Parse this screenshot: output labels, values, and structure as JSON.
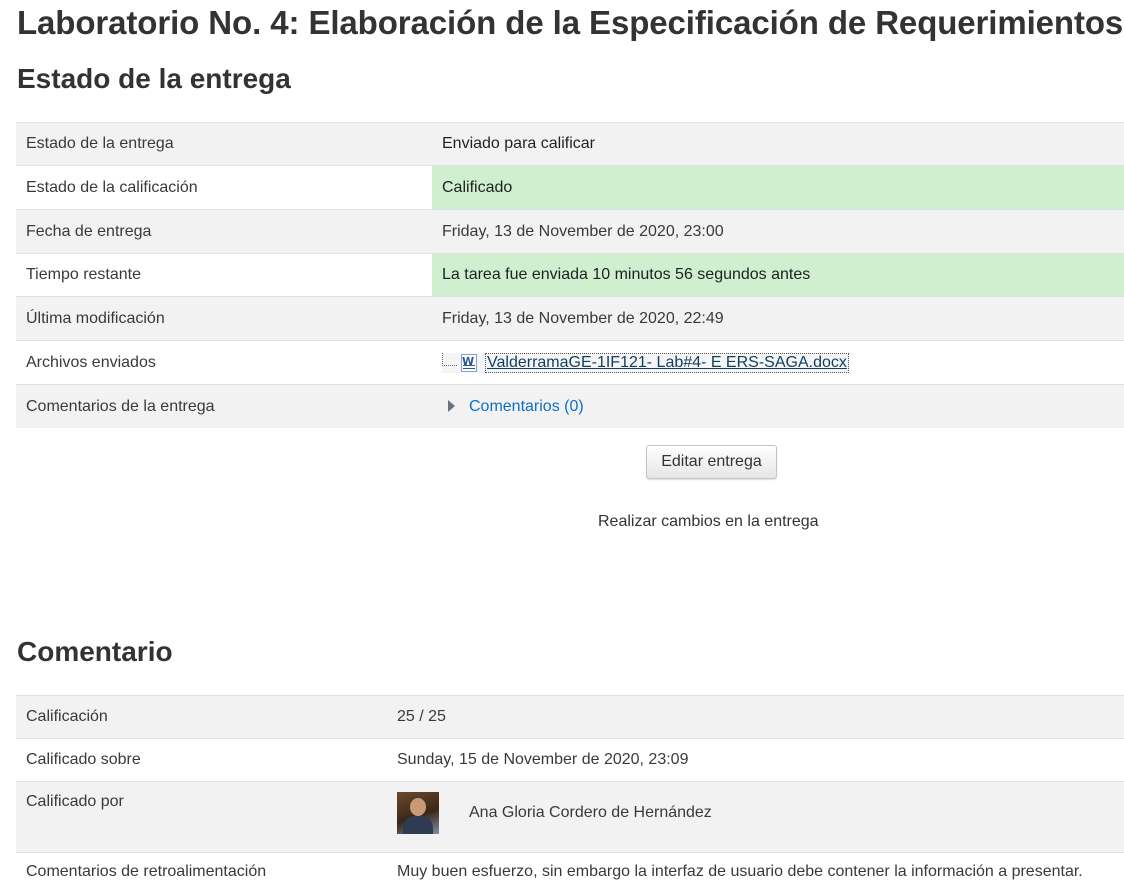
{
  "page": {
    "title": "Laboratorio No. 4: Elaboración de la Especificación de Requerimientos."
  },
  "submission_status": {
    "heading": "Estado de la entrega",
    "rows": [
      {
        "label": "Estado de la entrega",
        "value": "Enviado para calificar"
      },
      {
        "label": "Estado de la calificación",
        "value": "Calificado"
      },
      {
        "label": "Fecha de entrega",
        "value": "Friday, 13 de November de 2020, 23:00"
      },
      {
        "label": "Tiempo restante",
        "value": "La tarea fue enviada 10 minutos 56 segundos antes"
      },
      {
        "label": "Última modificación",
        "value": "Friday, 13 de November de 2020, 22:49"
      },
      {
        "label": "Archivos enviados",
        "value": "ValderramaGE-1IF121- Lab#4- E ERS-SAGA.docx",
        "icon": "word-document-icon"
      },
      {
        "label": "Comentarios de la entrega",
        "value": "Comentarios (0)"
      }
    ],
    "highlight_color": "#cfefcf",
    "edit_button_label": "Editar entrega",
    "edit_help_text": "Realizar cambios en la entrega"
  },
  "feedback": {
    "heading": "Comentario",
    "rows": [
      {
        "label": "Calificación",
        "value": "25 / 25"
      },
      {
        "label": "Calificado sobre",
        "value": "Sunday, 15 de November de 2020, 23:09"
      },
      {
        "label": "Calificado por",
        "value": "Ana Gloria Cordero de Hernández"
      },
      {
        "label": "Comentarios de retroalimentación",
        "value": "Muy buen esfuerzo, sin embargo la interfaz de usuario debe contener la información a presentar."
      }
    ]
  },
  "colors": {
    "link": "#0f6fc5",
    "row_stripe": "#f2f2f2"
  }
}
